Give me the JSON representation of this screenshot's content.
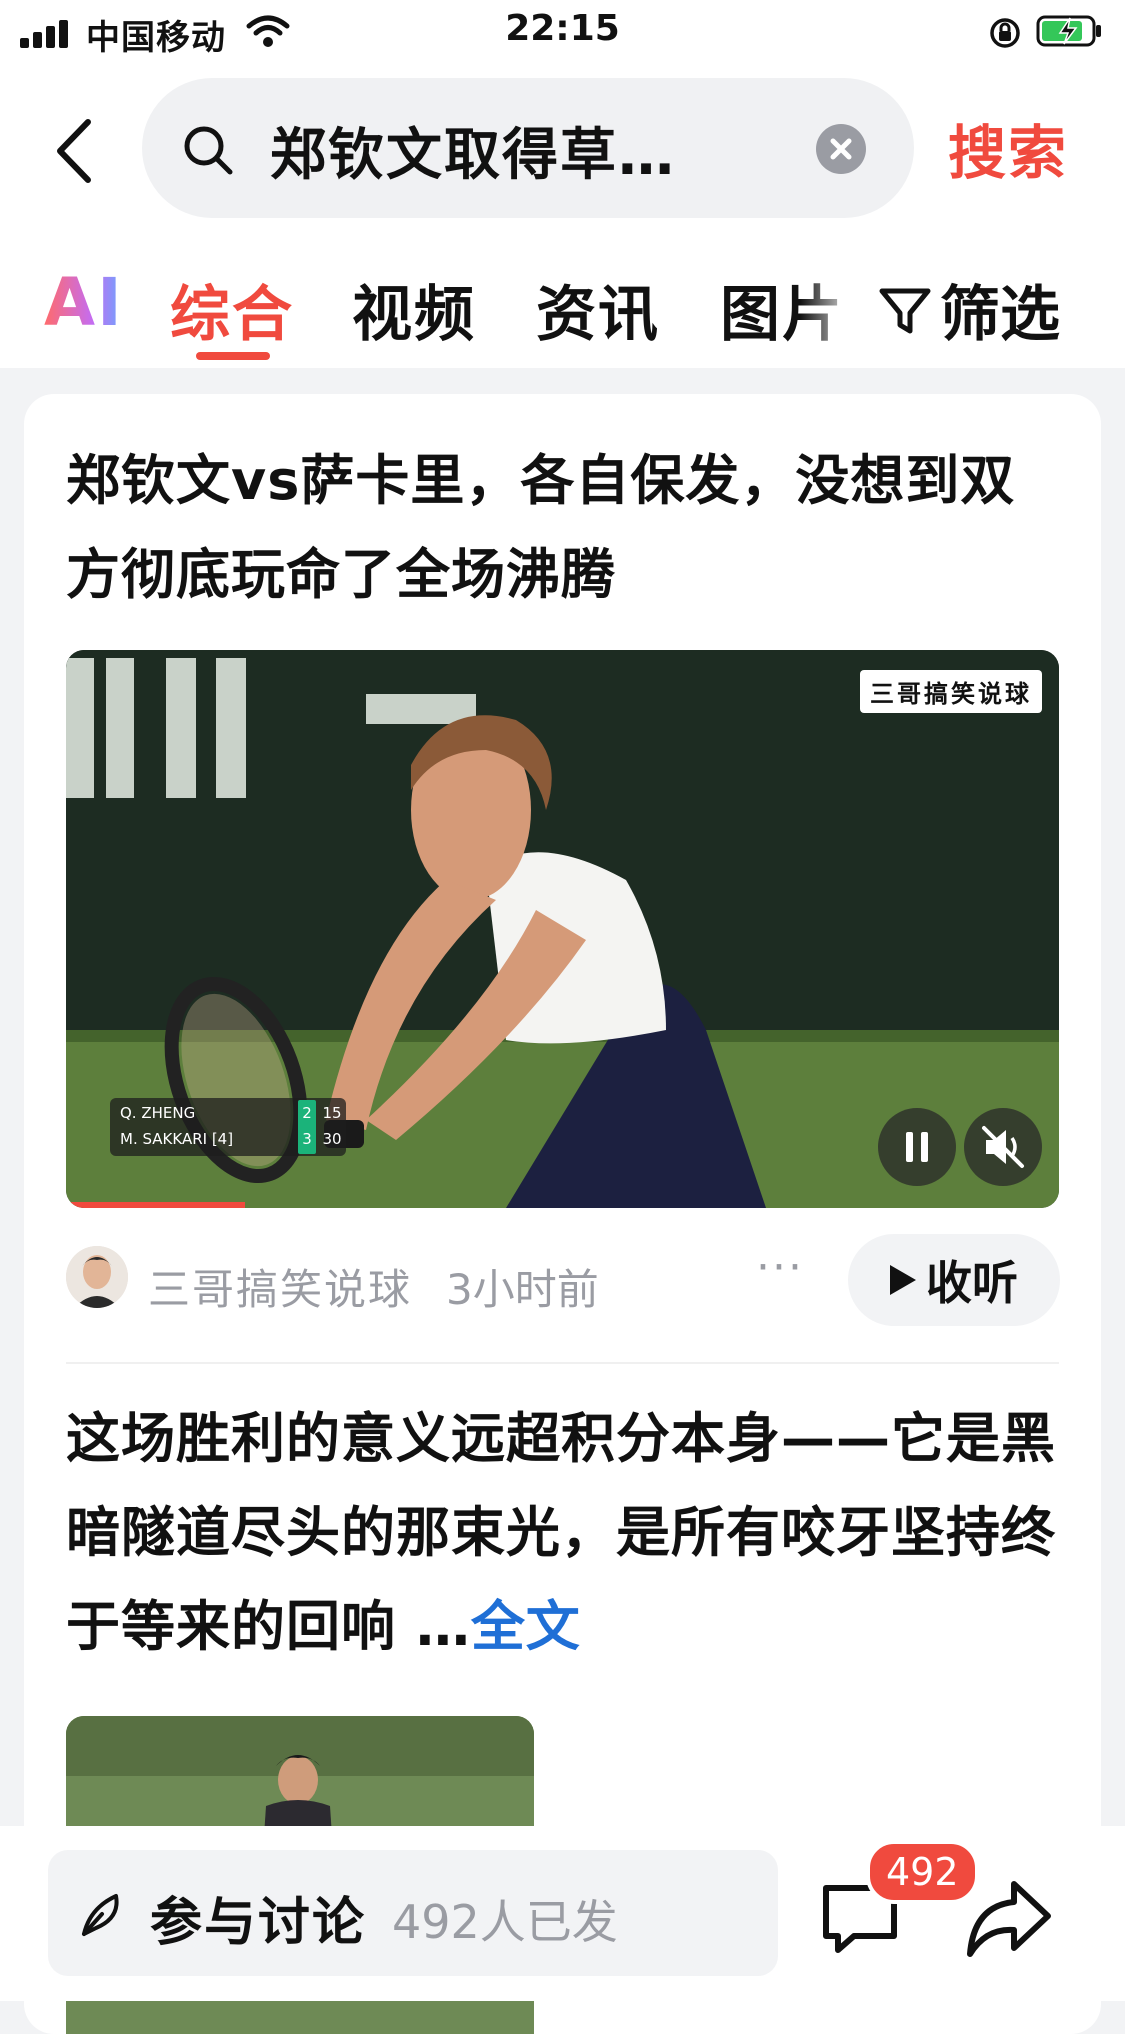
{
  "status_bar": {
    "carrier": "中国移动",
    "time": "22:15"
  },
  "search": {
    "query": "郑钦文取得草…",
    "button_label": "搜索"
  },
  "tabs": {
    "ai_label": "AI",
    "items": [
      "综合",
      "视频",
      "资讯",
      "图片"
    ],
    "active_index": 0,
    "filter_label": "筛选"
  },
  "result": {
    "title": "郑钦文vs萨卡里，各自保发，没想到双方彻底玩命了全场沸腾",
    "video": {
      "watermark": "三哥搞笑说球",
      "scoreboard": {
        "players": [
          {
            "name": "Q. ZHENG",
            "games": "2",
            "points": "15"
          },
          {
            "name": "M. SAKKARI [4]",
            "games": "3",
            "points": "30"
          }
        ]
      },
      "progress_fraction": 0.18
    },
    "author": "三哥搞笑说球",
    "time_ago": "3小时前",
    "more_label": "···",
    "listen_label": "收听"
  },
  "second_item": {
    "text": "这场胜利的意义远超积分本身——它是黑暗隧道尽头的那束光，是所有咬牙坚持终于等来的回响",
    "ellipsis": "…",
    "read_more": "全文"
  },
  "bottom_bar": {
    "discuss_label": "参与讨论",
    "discuss_count": "492人已发",
    "comment_badge": "492"
  },
  "colors": {
    "accent": "#f04a3e",
    "link": "#1f6fd6",
    "muted": "#9a9ca3"
  }
}
